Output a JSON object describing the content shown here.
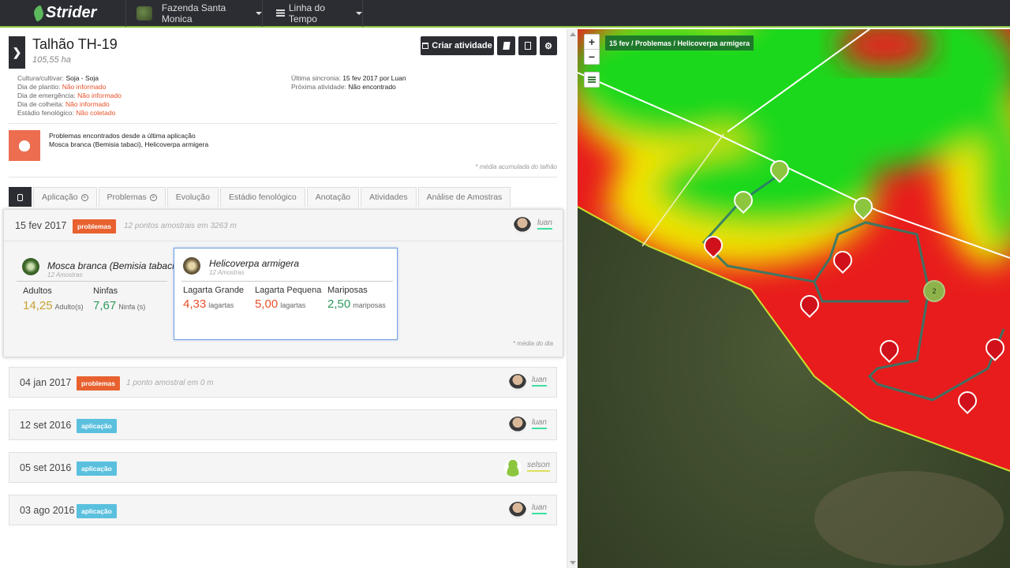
{
  "topbar": {
    "brand": "Strider",
    "farm": "Fazenda Santa Monica",
    "view": "Linha do Tempo"
  },
  "header": {
    "title": "Talhão TH-19",
    "area": "105,55 ha",
    "create_activity": "Criar atividade"
  },
  "details": {
    "culture_label": "Cultura/cultivar:",
    "culture_value": "Soja - Soja",
    "planting_label": "Dia de plantio:",
    "planting_value": "Não informado",
    "emergence_label": "Dia de emergência:",
    "emergence_value": "Não informado",
    "harvest_label": "Dia de colheita:",
    "harvest_value": "Não informado",
    "phenology_label": "Estádio fenológico:",
    "phenology_value": "Não coletado",
    "sync_label": "Última sincronia:",
    "sync_value": "15 fev 2017 por Luan",
    "next_label": "Próxima atividade:",
    "next_value": "Não encontrado"
  },
  "problems_alert": {
    "title": "Problemas encontrados desde a última aplicação",
    "text": "Mosca branca (Bemisia tabaci), Helicoverpa armigera",
    "note": "* média acumulada do talhão"
  },
  "tabs": [
    "Aplicação",
    "Problemas",
    "Evolução",
    "Estádio fenológico",
    "Anotação",
    "Atividades",
    "Análise de Amostras"
  ],
  "timeline": [
    {
      "date": "15 fev 2017",
      "badge": "problemas",
      "meta": "12 pontos amostrais em 3263 m",
      "user": "luan",
      "note": "* média do dia",
      "pests": [
        {
          "name": "Mosca branca (Bemisia tabaci)",
          "samples": "12 Amostras",
          "metrics": [
            {
              "label": "Adultos",
              "value": "14,25",
              "unit": "Adulto(s)",
              "color": "#c8a032"
            },
            {
              "label": "Ninfas",
              "value": "7,67",
              "unit": "Ninfa (s)",
              "color": "#2e9a5e"
            }
          ]
        },
        {
          "name": "Helicoverpa armigera",
          "samples": "12 Amostras",
          "metrics": [
            {
              "label": "Lagarta Grande",
              "value": "4,33",
              "unit": "lagartas",
              "color": "#e8512a"
            },
            {
              "label": "Lagarta Pequena",
              "value": "5,00",
              "unit": "lagartas",
              "color": "#e8512a"
            },
            {
              "label": "Mariposas",
              "value": "2,50",
              "unit": "mariposas",
              "color": "#2e9a5e"
            }
          ]
        }
      ]
    },
    {
      "date": "04 jan 2017",
      "badge": "problemas",
      "meta": "1 ponto amostral em 0 m",
      "user": "luan"
    },
    {
      "date": "12 set 2016",
      "badge": "aplicação",
      "meta": "",
      "user": "luan"
    },
    {
      "date": "05 set 2016",
      "badge": "aplicação",
      "meta": "",
      "user": "selson"
    },
    {
      "date": "03 ago 2016",
      "badge": "aplicação",
      "meta": "",
      "user": "luan"
    }
  ],
  "map": {
    "breadcrumb": "15 fev / Problemas / Helicoverpa armigera",
    "zoom_in": "+",
    "zoom_out": "−",
    "cluster_count": "2",
    "colors": {
      "high": "#e81c1c",
      "mid": "#f5e600",
      "low": "#1ed81e"
    }
  }
}
